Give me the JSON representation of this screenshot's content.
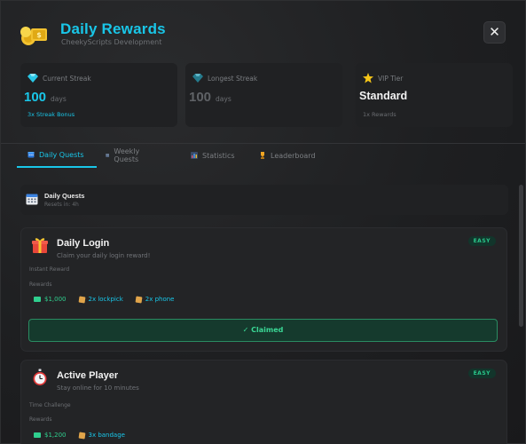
{
  "header": {
    "title": "Daily Rewards",
    "subtitle": "CheekyScripts Development",
    "close_label": "✕"
  },
  "stats": [
    {
      "label": "Current Streak",
      "value": "100",
      "unit": "days",
      "foot": "3x Streak Bonus",
      "value_color": "#19c6e8",
      "foot_color": "#19c6e8",
      "icon": "diamond-icon"
    },
    {
      "label": "Longest Streak",
      "value": "100",
      "unit": "days",
      "foot": "",
      "value_color": "#6a6d71",
      "foot_color": "#6a6d71",
      "icon": "diamond-icon"
    },
    {
      "label": "VIP Tier",
      "value": "Standard",
      "unit": "",
      "foot": "1x Rewards",
      "value_color": "#f2f2f2",
      "foot_color": "#6a6d71",
      "icon": "star-icon"
    }
  ],
  "tabs": [
    {
      "label": "Daily Quests",
      "icon": "calendar-icon",
      "active": true
    },
    {
      "label": "Weekly Quests",
      "icon": "calendar-icon",
      "active": false
    },
    {
      "label": "Statistics",
      "icon": "bar-chart-icon",
      "active": false
    },
    {
      "label": "Leaderboard",
      "icon": "trophy-icon",
      "active": false
    }
  ],
  "section": {
    "title": "Daily Quests",
    "subtitle": "Resets in: 4h"
  },
  "quests": [
    {
      "title": "Daily Login",
      "description": "Claim your daily login reward!",
      "difficulty": "EASY",
      "type": "Instant Reward",
      "rewards_label": "Rewards",
      "rewards": [
        {
          "label": "$1,000",
          "kind": "money"
        },
        {
          "label": "2x lockpick",
          "kind": "item"
        },
        {
          "label": "2x phone",
          "kind": "item"
        }
      ],
      "status": "✓ Claimed",
      "icon": "gift-icon"
    },
    {
      "title": "Active Player",
      "description": "Stay online for 10 minutes",
      "difficulty": "EASY",
      "type": "Time Challenge",
      "rewards_label": "Rewards",
      "rewards": [
        {
          "label": "$1,200",
          "kind": "money"
        },
        {
          "label": "3x bandage",
          "kind": "item"
        }
      ],
      "icon": "stopwatch-icon"
    }
  ]
}
